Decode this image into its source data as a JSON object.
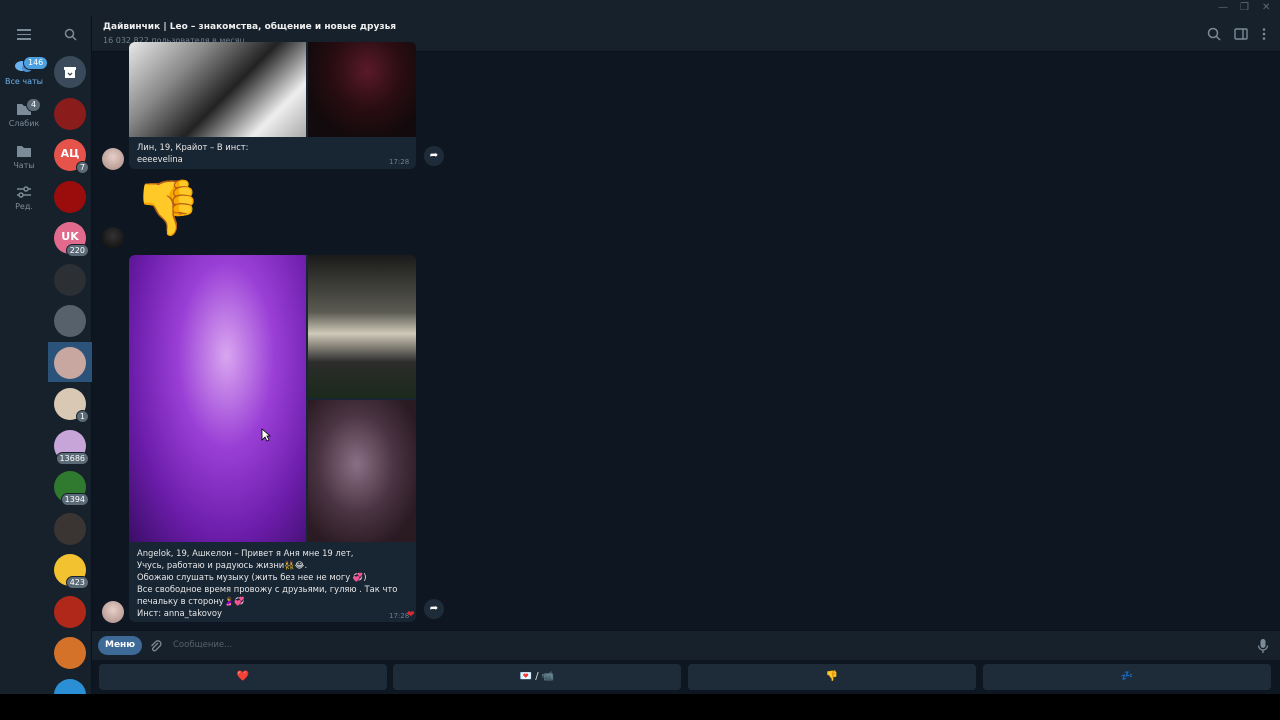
{
  "header": {
    "title": "Дайвинчик | Leo – знакомства, общение и новые друзья",
    "subtitle": "16 032 822 пользователя в месяц"
  },
  "folders": [
    {
      "label": "Все чаты",
      "badge": "146",
      "icon": "chat-bubbles-icon",
      "active": true
    },
    {
      "label": "Слабик",
      "badge": "4",
      "icon": "folder-icon",
      "active": false
    },
    {
      "label": "Чаты",
      "badge": "",
      "icon": "folder-icon",
      "active": false
    },
    {
      "label": "Ред.",
      "badge": "",
      "icon": "sliders-icon",
      "active": false
    }
  ],
  "chats": [
    {
      "name": "archive",
      "badge": "",
      "color": "#3b4a5a"
    },
    {
      "name": "rose-avatar",
      "badge": "",
      "color": "#8a1c1c"
    },
    {
      "name": "АЦ",
      "badge": "7",
      "color": "#e5534b"
    },
    {
      "name": "red-circle-avatar",
      "badge": "",
      "color": "#9b0d0d"
    },
    {
      "name": "UK",
      "badge": "220",
      "color": "#e26a8d"
    },
    {
      "name": "dark-avatar",
      "badge": "",
      "color": "#2c2f33"
    },
    {
      "name": "car-avatar",
      "badge": "",
      "color": "#56616b"
    },
    {
      "name": "leo-avatar",
      "badge": "",
      "color": "#c9a7a1"
    },
    {
      "name": "cat-avatar",
      "badge": "1",
      "color": "#d9c8b4"
    },
    {
      "name": "kawaii-avatar",
      "badge": "13686",
      "color": "#c7a5d8"
    },
    {
      "name": "green-avatar",
      "badge": "1394",
      "color": "#2f7a2f"
    },
    {
      "name": "man-avatar",
      "badge": "",
      "color": "#3a3533"
    },
    {
      "name": "emoji-avatar",
      "badge": "423",
      "color": "#f2c230"
    },
    {
      "name": "devil-avatar",
      "badge": "",
      "color": "#b0281a"
    },
    {
      "name": "fox-avatar",
      "badge": "",
      "color": "#d4722a"
    },
    {
      "name": "blue-avatar",
      "badge": "",
      "color": "#2a8fd4"
    }
  ],
  "messages": {
    "m1": {
      "caption": "Лин, 19, Крайот – В инст:\neeeevelina",
      "time": "17:28"
    },
    "m2": {
      "emoji": "👎"
    },
    "m3": {
      "caption": "Angelok, 19, Ашкелон – Привет я Аня мне 19 лет,\nУчусь, работаю и радуюсь жизни👯‍♀️😂.\nОбожаю слушать музыку (жить без нее не могу 💞)\nВсе свободное время провожу с друзьями, гуляю . Так что\nпечальку в сторону🤰💞\nИнст: anna_takovoy",
      "time": "17:28",
      "reaction": "❤"
    }
  },
  "input": {
    "menu_label": "Меню",
    "placeholder": "Сообщение..."
  },
  "keyboard": [
    "❤️",
    "💌 / 📹",
    "👎",
    "💤"
  ],
  "colors": {
    "accent": "#3d6a97",
    "bg": "#0e1621",
    "panel": "#17212b",
    "bubble": "#182533"
  }
}
